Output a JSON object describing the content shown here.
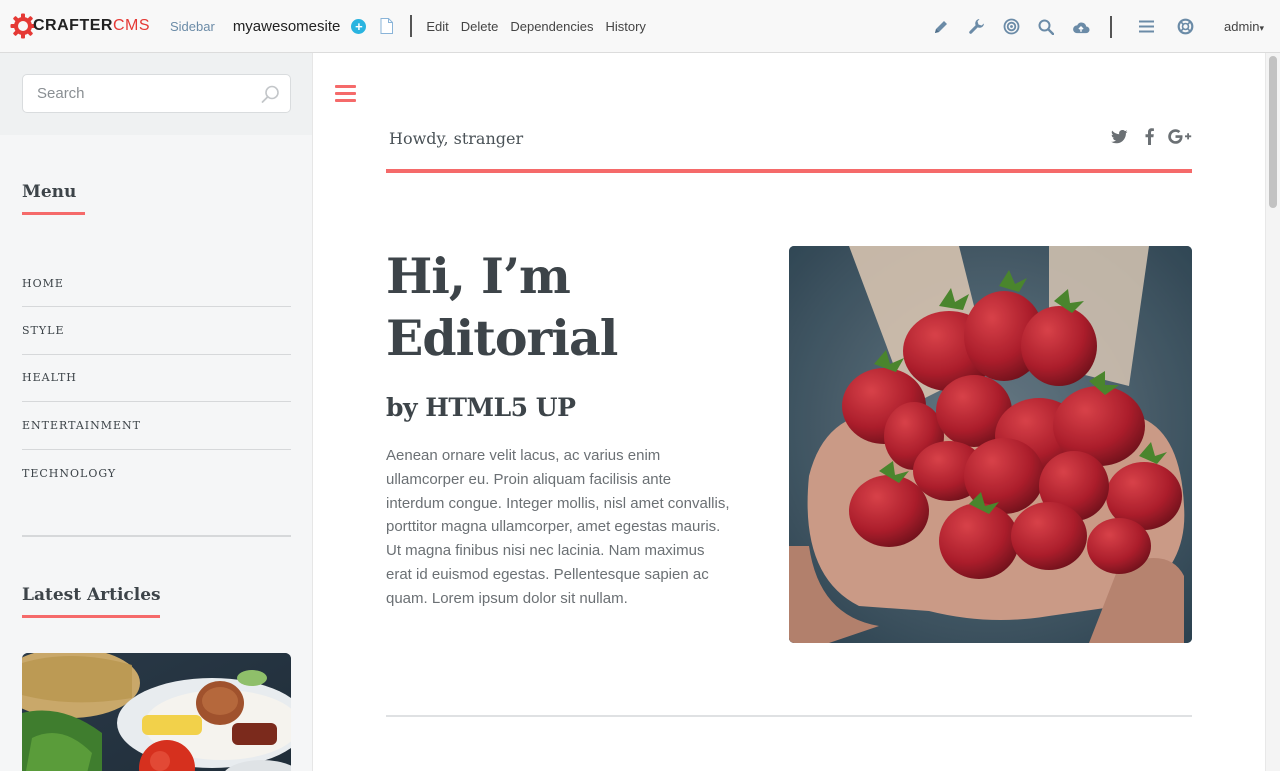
{
  "toolbar": {
    "logo": {
      "crafter": "CRAFTER",
      "cms": "CMS"
    },
    "sidebar_label": "Sidebar",
    "site_name": "myawesomesite",
    "actions": [
      "Edit",
      "Delete",
      "Dependencies",
      "History"
    ],
    "user": "admin",
    "icons": [
      "plus-circle-icon",
      "document-icon",
      "pencil-icon",
      "wrench-icon",
      "target-icon",
      "search-icon",
      "cloud-upload-icon",
      "menu-icon",
      "lifebuoy-icon"
    ]
  },
  "sidebar": {
    "search_placeholder": "Search",
    "menu_title": "Menu",
    "menu_items": [
      "HOME",
      "STYLE",
      "HEALTH",
      "ENTERTAINMENT",
      "TECHNOLOGY"
    ],
    "articles_title": "Latest Articles"
  },
  "main": {
    "greeting": "Howdy, stranger",
    "socials": [
      "twitter-icon",
      "facebook-icon",
      "google-plus-icon"
    ],
    "hero_title_line1": "Hi, I’m",
    "hero_title_line2": "Editorial",
    "hero_subtitle": "by HTML5 UP",
    "hero_body": "Aenean ornare velit lacus, ac varius enim ullamcorper eu. Proin aliquam facilisis ante interdum congue. Integer mollis, nisl amet convallis, porttitor magna ullamcorper, amet egestas mauris. Ut magna finibus nisi nec lacinia. Nam maximus erat id euismod egestas. Pellentesque sapien ac quam. Lorem ipsum dolor sit nullam."
  },
  "colors": {
    "accent": "#f56a6a",
    "logo_red": "#e53935",
    "toolbar_link": "#6b8ba7",
    "plus_blue": "#2ab4e0",
    "text_dark": "#3d4449"
  }
}
